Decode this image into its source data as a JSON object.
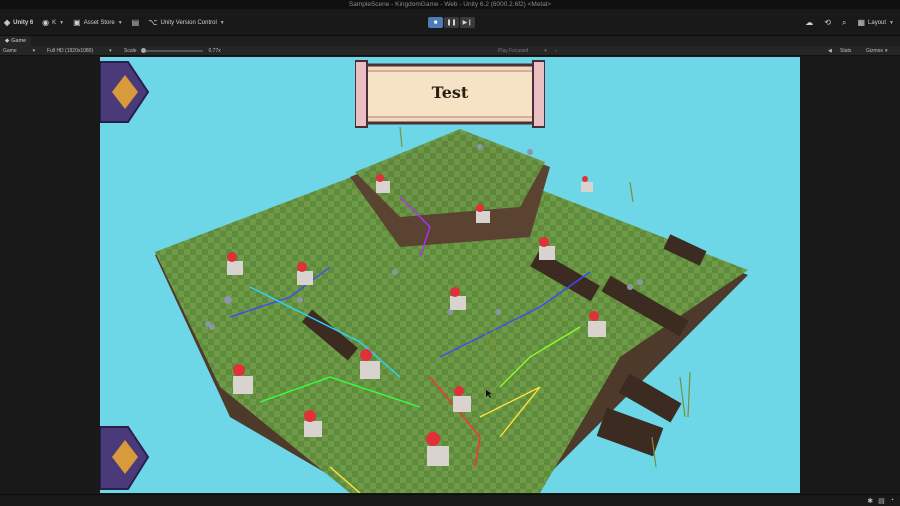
{
  "window": {
    "title": "SampleScene - KingdomGame - Web - Unity 6.2 (6000.2.6f2) <Metal>"
  },
  "toolbar": {
    "unity_label": "Unity 6",
    "account_label": "K",
    "asset_store_label": "Asset Store",
    "version_control_label": "Unity Version Control",
    "layout_label": "Layout"
  },
  "tabs": [
    {
      "label": "Game"
    }
  ],
  "gamebar": {
    "display": "Game",
    "resolution": "Full HD (1920x1080)",
    "scale_label": "Scale",
    "scale_value": "0.77x",
    "play_mode": "Play Focused",
    "stats_label": "Stats",
    "gizmos_label": "Gizmos"
  },
  "game": {
    "banner_text": "Test"
  },
  "icons": {
    "play": "play-icon",
    "pause": "pause-icon",
    "step": "step-icon",
    "cloud": "cloud-icon",
    "history": "history-icon",
    "search": "search-icon"
  },
  "colors": {
    "editor_bg": "#191919",
    "sky": "#6dd7e8",
    "grass": "#5e8a3a",
    "dirt": "#5a4330",
    "play_active": "#4e7bb8"
  }
}
